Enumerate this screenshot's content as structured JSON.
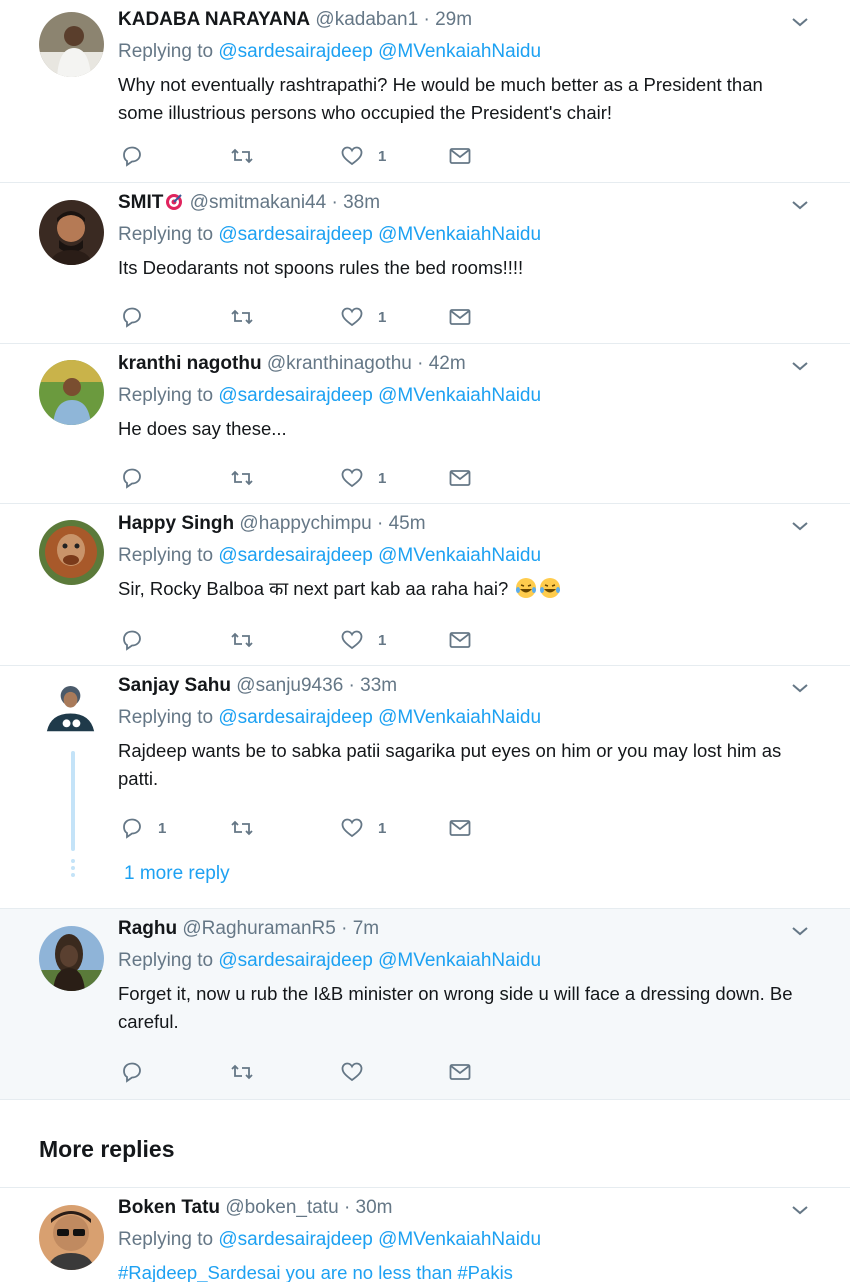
{
  "common": {
    "replying_label": "Replying to",
    "mention_1": "@sardesairajdeep",
    "mention_2": "@MVenkaiahNaidu",
    "dot": "·"
  },
  "tweets": [
    {
      "name": "KADABA NARAYANA",
      "handle": "@kadaban1",
      "time": "29m",
      "text": "Why not eventually rashtrapathi? He would be much better as a President than some illustrious persons who occupied the President's chair!",
      "reply_count": "",
      "like_count": "1",
      "avatar_icon": "person-photo-avatar"
    },
    {
      "name": "SMIT",
      "handle": "@smitmakani44",
      "time": "38m",
      "text": "Its Deodarants not spoons rules the bed rooms!!!!",
      "reply_count": "",
      "like_count": "1",
      "avatar_icon": "person-photo-avatar"
    },
    {
      "name": "kranthi nagothu",
      "handle": "@kranthinagothu",
      "time": "42m",
      "text": "He does say these...",
      "reply_count": "",
      "like_count": "1",
      "avatar_icon": "person-photo-avatar"
    },
    {
      "name": "Happy Singh",
      "handle": "@happychimpu",
      "time": "45m",
      "text": "Sir, Rocky Balboa का next part kab aa raha hai?",
      "reply_count": "",
      "like_count": "1",
      "avatar_icon": "orangutan-avatar"
    },
    {
      "name": "Sanjay Sahu",
      "handle": "@sanju9436",
      "time": "33m",
      "text": "Rajdeep wants be to sabka patii sagarika put eyes on him or you may lost him as patti.",
      "reply_count": "1",
      "like_count": "1",
      "avatar_icon": "person-photo-avatar"
    },
    {
      "name": "Raghu",
      "handle": "@RaghuramanR5",
      "time": "7m",
      "text": "Forget it, now u rub the I&B minister on wrong side u will face a dressing down. Be careful.",
      "reply_count": "",
      "like_count": "",
      "avatar_icon": "statue-avatar"
    },
    {
      "name": "Boken Tatu",
      "handle": "@boken_tatu",
      "time": "30m",
      "text": "#Rajdeep_Sardesai you are no less than #Pakis",
      "reply_count": "",
      "like_count": "",
      "avatar_icon": "person-photo-avatar"
    }
  ],
  "thread": {
    "more_reply_label": "1 more reply"
  },
  "section": {
    "more_replies_title": "More replies"
  },
  "colors": {
    "accent": "#1da1f2",
    "muted": "#657786",
    "border": "#e6ecf0",
    "thread_line": "#c4e3f8"
  }
}
